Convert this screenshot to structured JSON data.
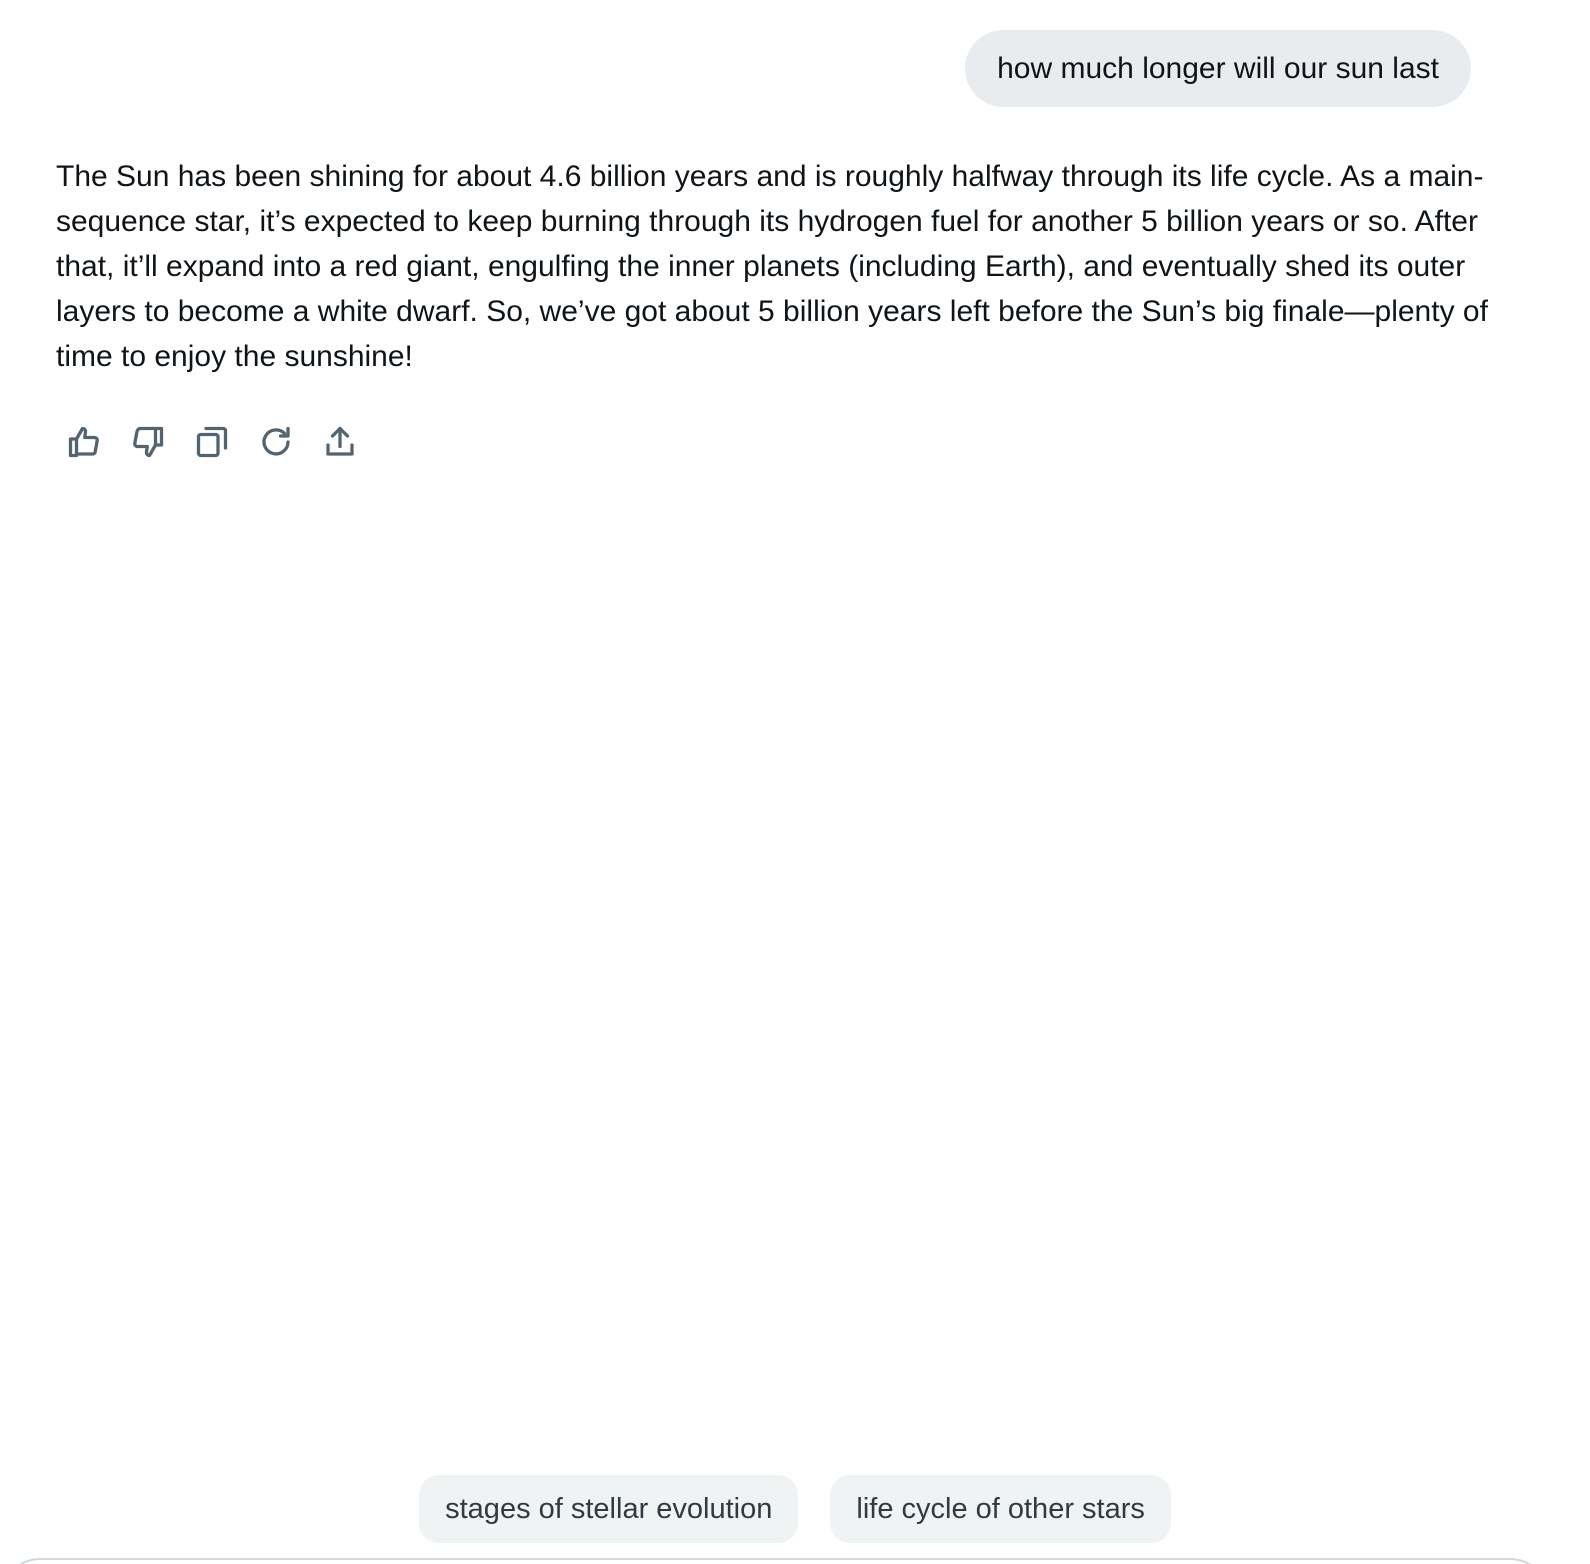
{
  "conversation": {
    "user_message": "how much longer will our sun last",
    "assistant_message": "The Sun has been shining for about 4.6 billion years and is roughly halfway through its life cycle. As a main-sequence star, it’s expected to keep burning through its hydrogen fuel for another 5 billion years or so. After that, it’ll expand into a red giant, engulfing the inner planets (including Earth), and eventually shed its outer layers to become a white dwarf. So, we’ve got about 5 billion years left before the Sun’s big finale—plenty of time to enjoy the sunshine!"
  },
  "actions": {
    "icons": [
      "thumbs-up-icon",
      "thumbs-down-icon",
      "copy-icon",
      "regenerate-icon",
      "share-icon"
    ]
  },
  "suggestions": [
    {
      "label": "stages of stellar evolution"
    },
    {
      "label": "life cycle of other stars"
    }
  ],
  "colors": {
    "user_bubble_bg": "#e8ecef",
    "chip_bg": "#eff3f4",
    "icon_stroke": "#536471",
    "text": "#0f1419"
  }
}
